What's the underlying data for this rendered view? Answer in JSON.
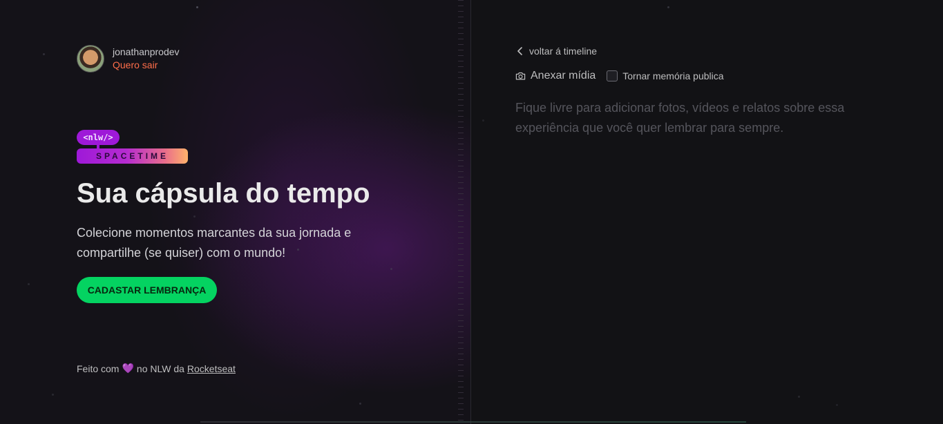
{
  "user": {
    "name": "jonathanprodev",
    "logout_label": "Quero sair"
  },
  "logo": {
    "top_text": "<nlw/>",
    "bottom_text": "SPACETIME"
  },
  "hero": {
    "title": "Sua cápsula do tempo",
    "subtitle": "Colecione momentos marcantes da sua jornada e compartilhe (se quiser) com o mundo!",
    "cta_label": "CADASTAR LEMBRANÇA"
  },
  "footer": {
    "prefix": "Feito com",
    "heart": "💜",
    "middle": "no NLW da",
    "link_label": "Rocketseat"
  },
  "form": {
    "back_label": "voltar á timeline",
    "attach_label": "Anexar mídia",
    "public_label": "Tornar memória publica",
    "public_checked": false,
    "content_placeholder": "Fique livre para adicionar fotos, vídeos e relatos sobre essa experiência que você quer lembrar para sempre.",
    "content_value": ""
  },
  "colors": {
    "accent_green": "#04d361",
    "logout_orange": "#ff6e4a",
    "brand_purple": "#9e19d8",
    "background": "#121215"
  },
  "icons": {
    "back": "chevron-left-icon",
    "attach": "camera-icon",
    "heart": "heart-icon"
  }
}
